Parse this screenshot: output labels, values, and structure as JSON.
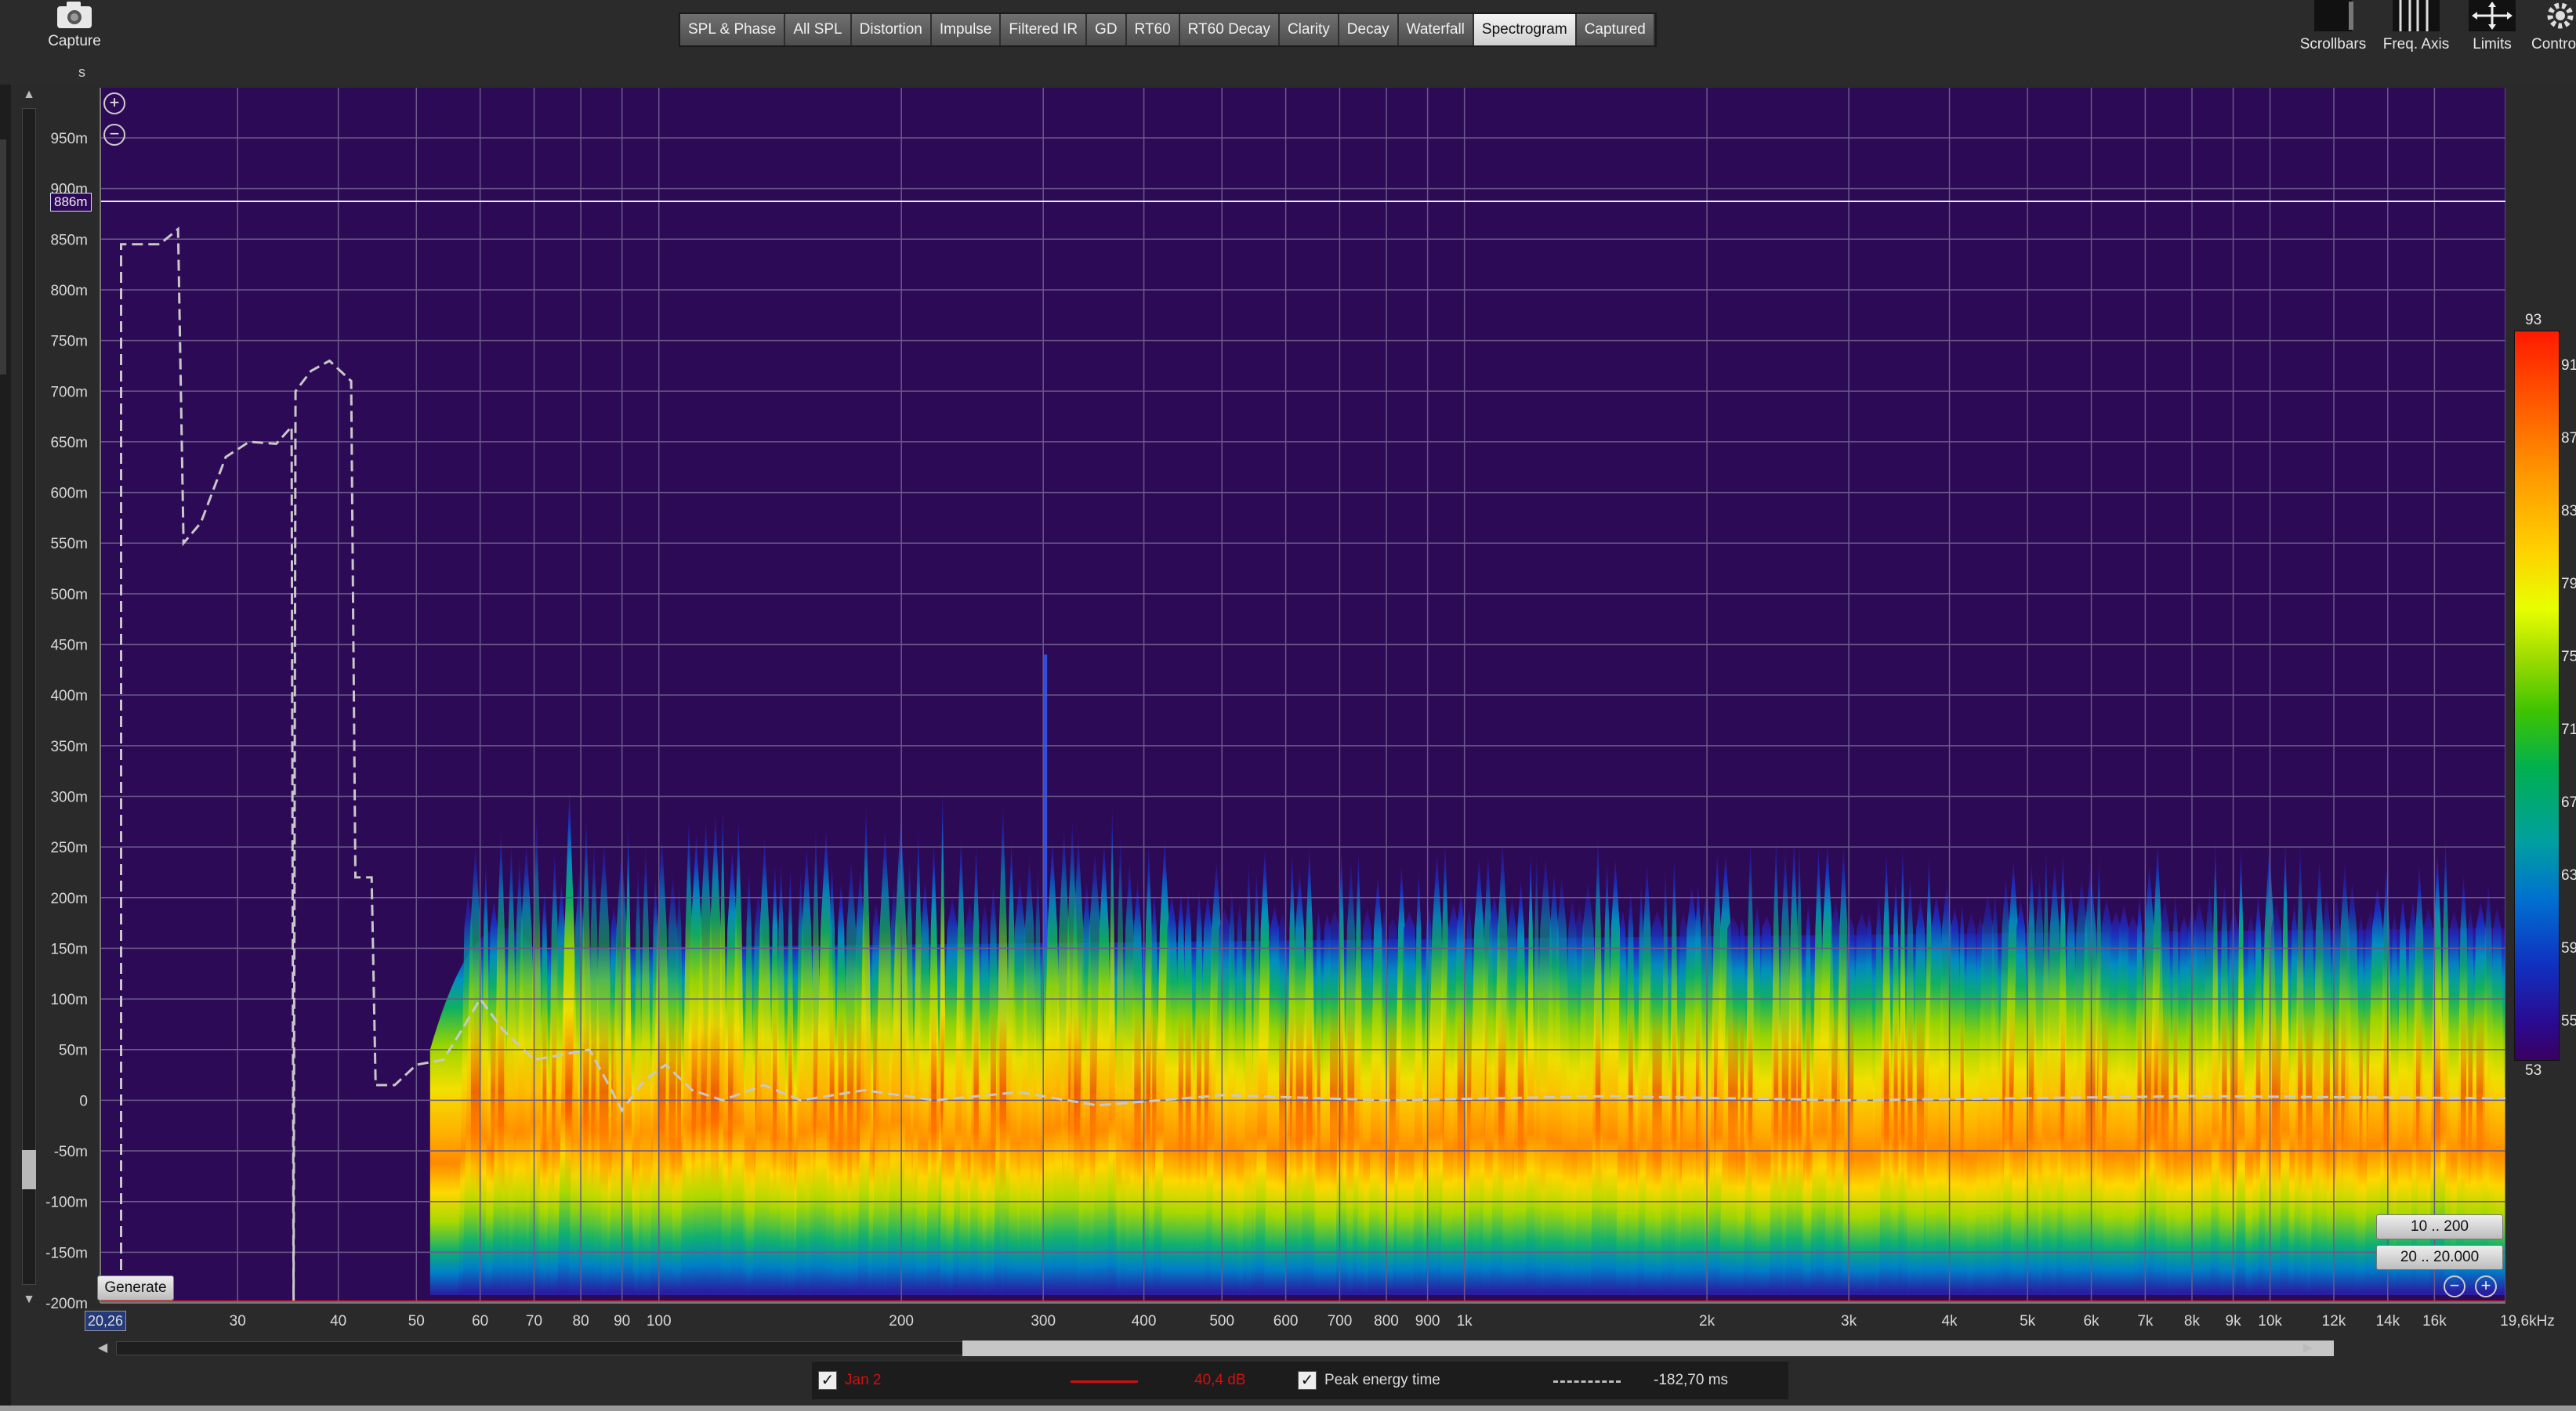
{
  "toolbar": {
    "capture_label": "Capture",
    "scrollbars_label": "Scrollbars",
    "freq_axis_label": "Freq. Axis",
    "limits_label": "Limits",
    "controls_label": "Contro",
    "tabs": [
      {
        "label": "SPL & Phase",
        "active": false
      },
      {
        "label": "All SPL",
        "active": false
      },
      {
        "label": "Distortion",
        "active": false
      },
      {
        "label": "Impulse",
        "active": false
      },
      {
        "label": "Filtered IR",
        "active": false
      },
      {
        "label": "GD",
        "active": false
      },
      {
        "label": "RT60",
        "active": false
      },
      {
        "label": "RT60 Decay",
        "active": false
      },
      {
        "label": "Clarity",
        "active": false
      },
      {
        "label": "Decay",
        "active": false
      },
      {
        "label": "Waterfall",
        "active": false
      },
      {
        "label": "Spectrogram",
        "active": true
      },
      {
        "label": "Captured",
        "active": false
      }
    ]
  },
  "plot": {
    "y_unit": "s",
    "y_ticks": [
      "950m",
      "900m",
      "850m",
      "800m",
      "750m",
      "700m",
      "650m",
      "600m",
      "550m",
      "500m",
      "450m",
      "400m",
      "350m",
      "300m",
      "250m",
      "200m",
      "150m",
      "100m",
      "50m",
      "0",
      "-50m",
      "-100m",
      "-150m",
      "-200m"
    ],
    "x_ticks": [
      "30",
      "40",
      "50",
      "60",
      "70",
      "80",
      "90",
      "100",
      "200",
      "300",
      "400",
      "500",
      "600",
      "700",
      "800",
      "900",
      "1k",
      "2k",
      "3k",
      "4k",
      "5k",
      "6k",
      "7k",
      "8k",
      "9k",
      "10k",
      "12k",
      "14k",
      "16k",
      "19,6kHz"
    ],
    "x_start_label": "20,26",
    "cursor_label": "886m",
    "generate_label": "Generate",
    "range_time": "10 .. 200",
    "range_freq": "20 .. 20.000",
    "background_color": "#2d0a55"
  },
  "colorbar": {
    "top_label": "93",
    "bottom_label": "53",
    "labels": [
      "91",
      "87",
      "83",
      "79",
      "75",
      "71",
      "67",
      "63",
      "59",
      "55"
    ]
  },
  "legend": {
    "series1_name": "Jan 2",
    "series1_value": "40,4 dB",
    "series1_color": "#d01010",
    "series2_name": "Peak energy time",
    "series2_value": "-182,70 ms"
  }
}
